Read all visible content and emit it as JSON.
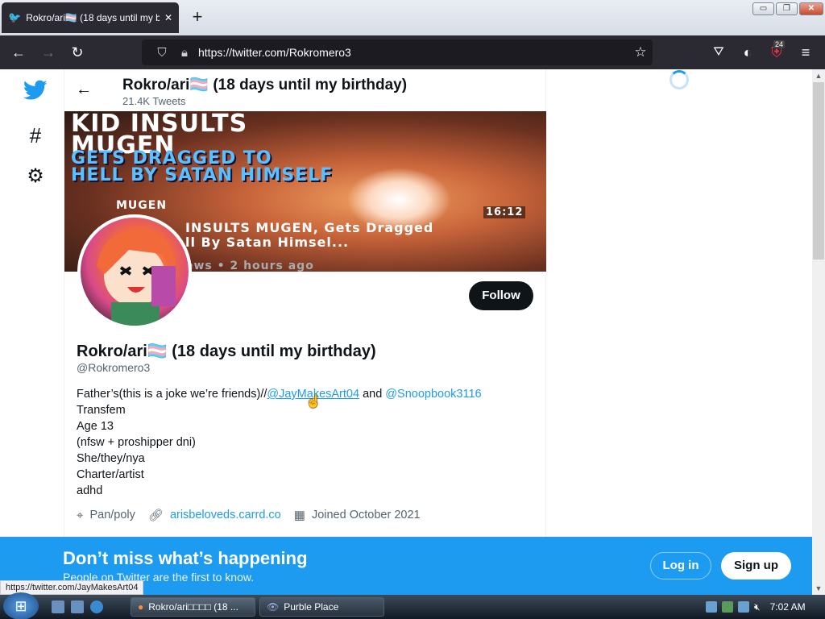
{
  "browser": {
    "tab_title": "Rokro/ari🏳️‍⚧️ (18 days until my bi",
    "new_tab": "+",
    "close_tab": "✕",
    "url": "https://twitter.com/Rokromero3",
    "pocket_badge": "24",
    "win_min": "▭",
    "win_max": "❐",
    "win_close": "✕"
  },
  "header": {
    "name": "Rokro/ari🏳️‍⚧️ (18 days until my birthday)",
    "tweets": "21.4K Tweets"
  },
  "banner": {
    "title_line1": "KID INSULTS",
    "title_line2": "MUGEN",
    "title_line3": "GETS DRAGGED TO",
    "title_line4": "HELL BY SATAN HIMSELF",
    "channel": "MUGEN",
    "duration": "16:12",
    "video_title": "INSULTS MUGEN, Gets Dragged",
    "video_title2": "ll By Satan Himsel...",
    "video_meta": "ews • 2 hours ago"
  },
  "profile": {
    "follow_label": "Follow",
    "name": "Rokro/ari🏳️‍⚧️ (18 days until my birthday)",
    "handle": "@Rokromero3",
    "bio_line1_prefix": "Father’s(this is a joke we’re friends)//",
    "bio_link1": "@JayMakesArt04",
    "bio_and": " and ",
    "bio_link2": "@Snoopbook3116",
    "bio_lines": [
      "Transfem",
      "Age 13",
      "(nfsw + proshipper dni)",
      "She/they/nya",
      "Charter/artist",
      "adhd"
    ],
    "location": "Pan/poly",
    "website": "arisbeloveds.carrd.co",
    "joined": "Joined October 2021"
  },
  "cta": {
    "heading": "Don’t miss what’s happening",
    "sub": "People on Twitter are the first to know.",
    "login": "Log in",
    "signup": "Sign up"
  },
  "status_url": "https://twitter.com/JayMakesArt04",
  "taskbar": {
    "task1": "Rokro/ari□□□□ (18 ...",
    "task2": "Purble Place",
    "clock": "7:02 AM"
  }
}
